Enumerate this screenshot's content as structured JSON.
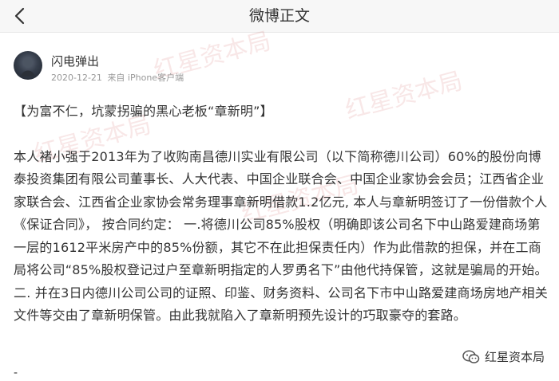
{
  "header": {
    "title": "微博正文",
    "back_icon": "chevron-left-icon"
  },
  "post": {
    "author": "闪电弹出",
    "date": "2020-12-21",
    "source": "来自 iPhone客户端",
    "headline": "【为富不仁，坑蒙拐骗的黑心老板“章新明”】",
    "paragraph1": "本人褚小强于2013年为了收购南昌德川实业有限公司（以下简称德川公司）60%的股份向博泰投资集团有限公司董事长、人大代表、中国企业联合会、中国企业家协会会员；江西省企业家联合会、江西省企业家协会常务理事章新明借款1.2亿元, 本人与章新明签订了一份借款个人《保证合同》， 按合同约定： 一.将德川公司85%股权（明确即该公司名下中山路爱建商场第一层的1612平米房产中的85%份额，其它不在此担保责任内）作为此借款的担保，并在工商局将公司“85%股权登记过户至章新明指定的人罗勇名下”由他代持保管，这就是骗局的开始。",
    "paragraph2": "二. 并在3日内德川公司公司的证照、印鉴、财务资料、公司名下市中山路爱建商场房地产相关文件等交由了章新明保管。由此我就陷入了章新明预先设计的巧取豪夺的套路。",
    "trailing": "-"
  },
  "watermark": {
    "text": "红星资本局"
  },
  "brand": {
    "label": "红星资本局",
    "icon": "wechat-icon"
  }
}
